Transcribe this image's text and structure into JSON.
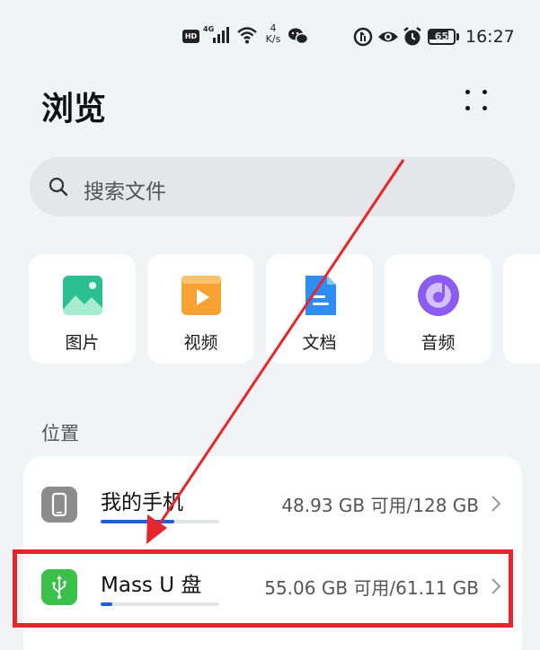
{
  "status_bar": {
    "hd": "HD",
    "network": "4G",
    "speed_value": "4",
    "speed_unit": "K/s",
    "battery": "65",
    "time": "16:27"
  },
  "header": {
    "title": "浏览"
  },
  "search": {
    "placeholder": "搜索文件"
  },
  "categories": [
    {
      "label": "图片",
      "icon": "image-icon",
      "color": "#2bbf8f"
    },
    {
      "label": "视频",
      "icon": "video-icon",
      "color": "#f7a233"
    },
    {
      "label": "文档",
      "icon": "document-icon",
      "color": "#2e8df5"
    },
    {
      "label": "音频",
      "icon": "audio-icon",
      "color": "#8a5cf0"
    }
  ],
  "locations": {
    "title": "位置",
    "items": [
      {
        "name": "我的手机",
        "size": "48.93 GB 可用/128 GB",
        "icon": "phone-icon",
        "icon_color": "#8c8c8c",
        "used_fraction": 0.62
      },
      {
        "name": "Mass U 盘",
        "size": "55.06 GB 可用/61.11 GB",
        "icon": "usb-icon",
        "icon_color": "#3bc14a",
        "used_fraction": 0.1
      }
    ]
  },
  "colors": {
    "accent": "#1e5fd9",
    "annotation": "#e5262c"
  }
}
